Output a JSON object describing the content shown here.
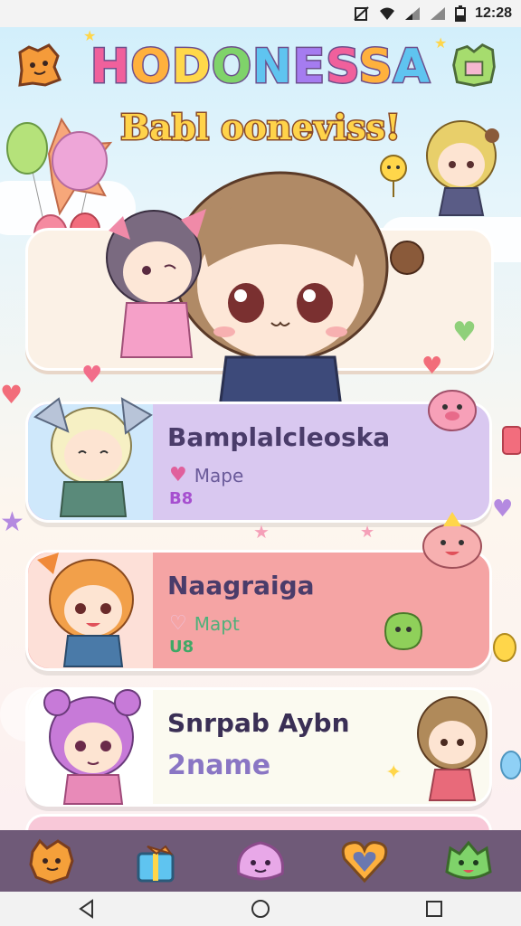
{
  "status_bar": {
    "time": "12:28"
  },
  "header": {
    "title": "HODONESSA",
    "title_letter_colors": [
      "#f0609c",
      "#ffb13d",
      "#ffd84a",
      "#7fd36a",
      "#5fc4f0",
      "#a57cf0",
      "#f0609c",
      "#ffb13d",
      "#5fc4f0"
    ],
    "subtitle": "Babl ooneviss!"
  },
  "cards": [
    {
      "name": "Bamplalcleoska",
      "meta": "Mape",
      "number": "B8",
      "color": "#d9c8f0"
    },
    {
      "name": "Naagraiga",
      "meta": "Mapt",
      "number": "U8",
      "color": "#f5a4a4"
    },
    {
      "name": "Snrpab Aybn",
      "subtitle": "2name",
      "color": "#fbfaf0"
    }
  ],
  "bottom_nav": {
    "items": [
      {
        "icon": "orange-creature-icon"
      },
      {
        "icon": "gift-box-icon"
      },
      {
        "icon": "pink-blob-icon"
      },
      {
        "icon": "heart-icon"
      },
      {
        "icon": "green-slime-icon"
      }
    ]
  },
  "system_nav": {
    "items": [
      {
        "icon": "back-icon"
      },
      {
        "icon": "home-icon"
      },
      {
        "icon": "recents-icon"
      }
    ]
  }
}
